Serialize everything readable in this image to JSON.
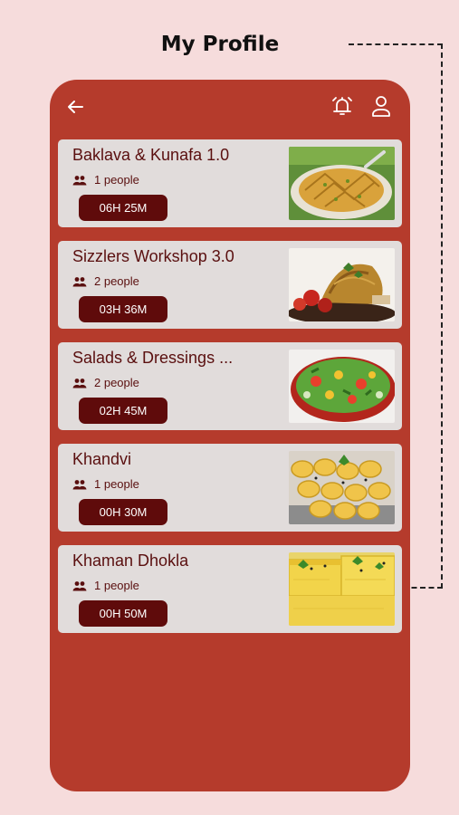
{
  "page": {
    "title": "My Profile"
  },
  "header": {
    "back_icon": "arrow-left-icon",
    "alarm_icon": "alarm-bell-icon",
    "profile_icon": "user-icon"
  },
  "colors": {
    "page_background": "#f6dcdc",
    "panel": "#b53b2c",
    "card": "#e1dcdb",
    "pill": "#5f0b0b",
    "text_dark": "#5a0f0f"
  },
  "workshops": [
    {
      "title": "Baklava & Kunafa 1.0",
      "people": "1 people",
      "time": "06H 25M",
      "image": "baklava-image"
    },
    {
      "title": "Sizzlers Workshop 3.0",
      "people": "2 people",
      "time": "03H 36M",
      "image": "sizzler-image"
    },
    {
      "title": "Salads & Dressings ...",
      "people": "2 people",
      "time": "02H 45M",
      "image": "salad-image"
    },
    {
      "title": "Khandvi",
      "people": "1 people",
      "time": "00H 30M",
      "image": "khandvi-image"
    },
    {
      "title": "Khaman Dhokla",
      "people": "1 people",
      "time": "00H 50M",
      "image": "dhokla-image"
    }
  ]
}
